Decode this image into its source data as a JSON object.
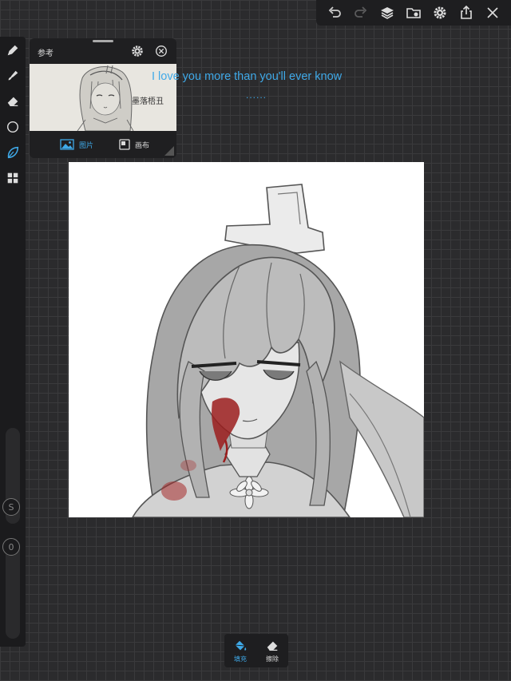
{
  "toolbar": {
    "icons": [
      "undo-icon",
      "redo-icon",
      "layers-icon",
      "gallery-icon",
      "settings-icon",
      "share-icon",
      "close-icon"
    ]
  },
  "reference_panel": {
    "title": "参考",
    "tab_image": "图片",
    "tab_canvas": "画布",
    "sketch_signature": "墨落梧丑"
  },
  "lyrics": {
    "line1": "I love you more than you'll ever know",
    "line2": "......"
  },
  "side_tools": {
    "icons": [
      "brush-icon",
      "smudge-icon",
      "eraser-icon",
      "shape-icon",
      "select-icon",
      "grid-icon"
    ],
    "size_knob": "S",
    "opacity_knob": "0"
  },
  "bottom_tools": {
    "fill_label": "填充",
    "erase_label": "擦除"
  },
  "colors": {
    "accent": "#3fa9e8",
    "panel": "#1e1e20",
    "canvas_bg": "#2b2b2d"
  }
}
